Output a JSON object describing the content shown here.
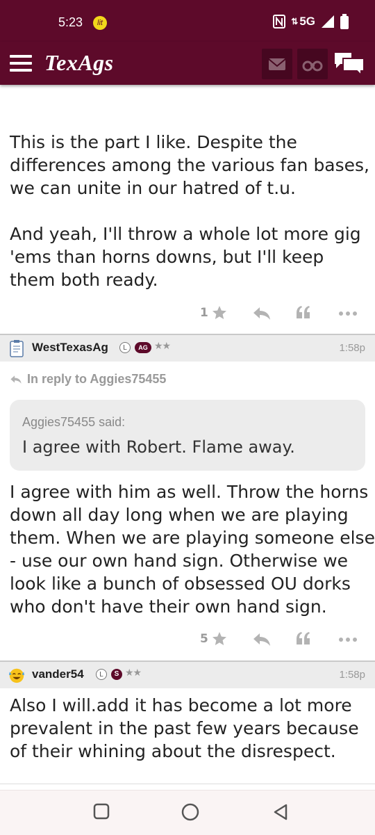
{
  "status": {
    "time": "5:23",
    "lit_label": "lit",
    "network": "5G"
  },
  "appbar": {
    "logo": "TexAgs",
    "icons": [
      "menu-icon",
      "mail-icon",
      "binoculars-icon",
      "chat-icon"
    ]
  },
  "posts": [
    {
      "text_lines": [
        "This is the part I like. Despite the",
        "differences among the various fan bases,",
        "we can unite in our hatred of t.u.",
        "",
        "And yeah, I'll throw a whole lot more gig",
        "'ems than horns downs, but I'll keep",
        "them both ready."
      ],
      "stars": "1"
    },
    {
      "username": "WestTexasAg",
      "badge_l": "L",
      "badge_team": "AG",
      "rating": "★★",
      "time": "1:58p",
      "in_reply_to": "In reply to Aggies75455",
      "quote_author": "Aggies75455 said:",
      "quote_text": "I agree with Robert. Flame away.",
      "text_lines": [
        "I agree with him as well. Throw the horns",
        "down all day long when we are playing",
        "them. When we are playing someone else",
        "- use our own hand sign. Otherwise we",
        "look like a bunch of obsessed OU dorks",
        "who don't have their own hand sign."
      ],
      "stars": "5"
    },
    {
      "username": "vander54",
      "badge_l": "L",
      "badge_team": "S",
      "rating": "★★",
      "time": "1:58p",
      "text_lines": [
        "Also I will.add it has become a lot more",
        "prevalent in the past few years because",
        "of their whining about the disrespect."
      ]
    }
  ],
  "colors": {
    "brand": "#5d0a2a",
    "header_bg": "#ececec",
    "muted": "#999999"
  }
}
